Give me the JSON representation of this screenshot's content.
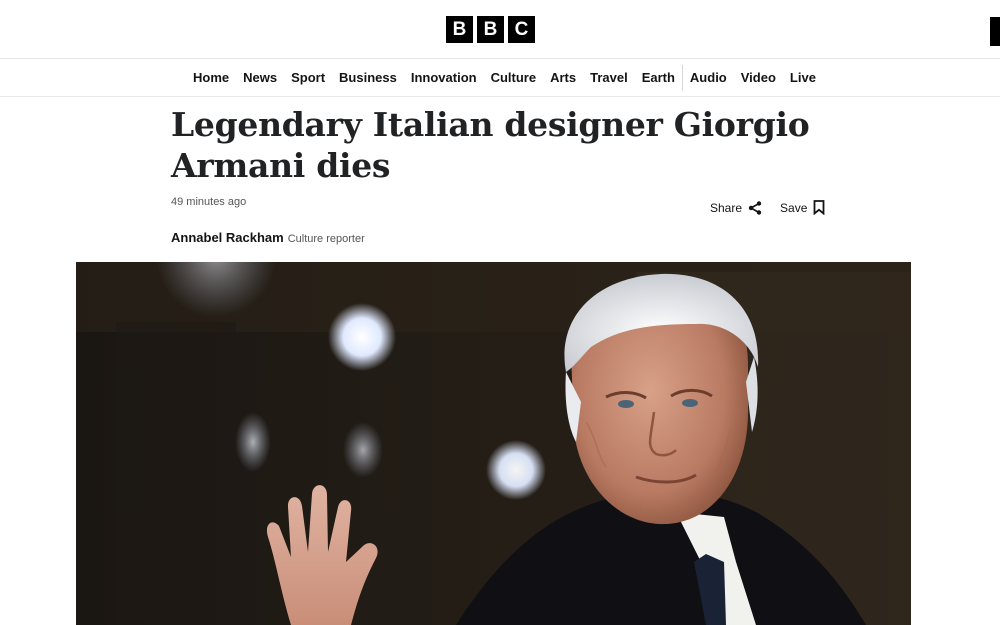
{
  "brand": {
    "letters": [
      "B",
      "B",
      "C"
    ]
  },
  "nav": {
    "items": [
      "Home",
      "News",
      "Sport",
      "Business",
      "Innovation",
      "Culture",
      "Arts",
      "Travel",
      "Earth"
    ],
    "media_items": [
      "Audio",
      "Video",
      "Live"
    ]
  },
  "article": {
    "headline": "Legendary Italian designer Giorgio Armani dies",
    "timestamp": "49 minutes ago",
    "author": "Annabel Rackham",
    "role": "Culture reporter",
    "share_label": "Share",
    "save_label": "Save"
  },
  "icons": {
    "share": "share-icon",
    "save": "bookmark-icon"
  }
}
